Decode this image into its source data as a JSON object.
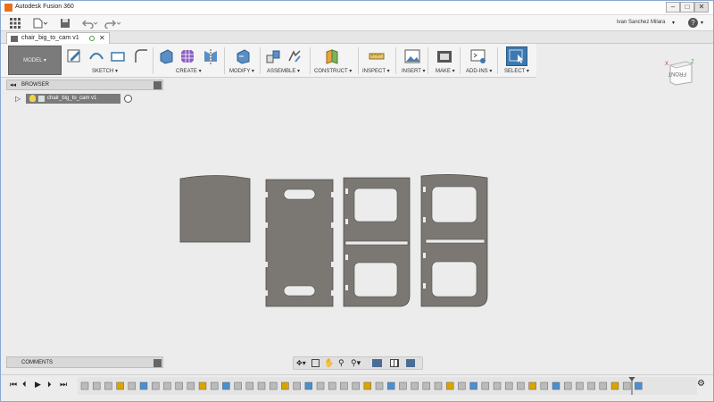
{
  "app": {
    "window_title": "Autodesk Fusion 360",
    "user_name": "Ivan Sanchez Milara"
  },
  "window_controls": {
    "minimize": "–",
    "maximize": "□",
    "close": "✕"
  },
  "doc_tab": {
    "label": "chair_big_to_cam v1"
  },
  "help": {
    "label": "?"
  },
  "ribbon": {
    "workspace": "MODEL",
    "groups": [
      "SKETCH",
      "CREATE",
      "MODIFY",
      "ASSEMBLE",
      "CONSTRUCT",
      "INSPECT",
      "INSERT",
      "MAKE",
      "ADD-INS",
      "SELECT"
    ]
  },
  "browser": {
    "header": "BROWSER",
    "item_label": "chair_big_to_cam v1"
  },
  "comments": {
    "header": "COMMENTS"
  },
  "viewcube": {
    "face_label": "FRONT",
    "axis_z": "Z",
    "axis_x": "X"
  },
  "colors": {
    "part_fill": "#7b7874",
    "part_stroke": "#4f4d4a",
    "hole_fill": "#ececec",
    "accent_select": "#3d79b0",
    "timeline_marker": "#d9a400"
  },
  "icons": {
    "app_grid": "grid-icon",
    "file": "file-icon",
    "save": "save-icon",
    "undo": "undo-icon",
    "redo": "redo-icon"
  }
}
